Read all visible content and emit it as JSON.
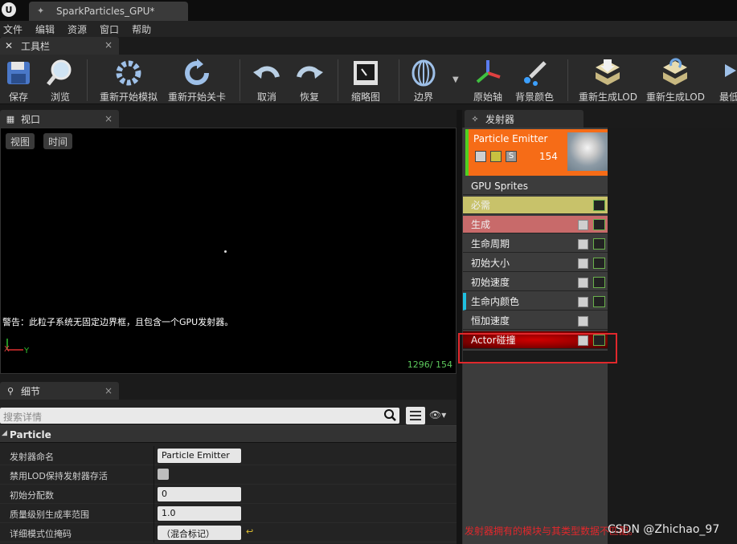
{
  "window": {
    "tab_title": "SparkParticles_GPU*"
  },
  "menu": [
    "文件",
    "编辑",
    "资源",
    "窗口",
    "帮助"
  ],
  "toolbar_tab": {
    "label": "工具栏"
  },
  "toolbar": {
    "buttons": [
      "保存",
      "浏览",
      "重新开始模拟",
      "重新开始关卡",
      "取消",
      "恢复",
      "缩略图",
      "边界",
      "原始轴",
      "背景颜色",
      "重新生成LOD",
      "重新生成LOD",
      "最低"
    ]
  },
  "viewport": {
    "tab_label": "视口",
    "view_button": "视图",
    "time_button": "时间",
    "warning": "警告：此粒子系统无固定边界框，且包含一个GPU发射器。",
    "counter": "1296/ 154",
    "axis_x": "X",
    "axis_y": "Y"
  },
  "details": {
    "tab_label": "细节",
    "search_placeholder": "搜索详情",
    "category": "Particle",
    "properties": [
      {
        "name": "发射器命名",
        "value": "Particle Emitter"
      },
      {
        "name": "禁用LOD保持发射器存活",
        "value": ""
      },
      {
        "name": "初始分配数",
        "value": "0"
      },
      {
        "name": "质量级别生成率范围",
        "value": "1.0"
      },
      {
        "name": "详细模式位掩码",
        "value": "（混合标记）"
      }
    ]
  },
  "emitters": {
    "tab_label": "发射器",
    "emitter_name": "Particle Emitter",
    "emitter_count": "154",
    "solo_label": "S",
    "type_row": "GPU Sprites",
    "modules": [
      "必需",
      "生成",
      "生命周期",
      "初始大小",
      "初始速度",
      "生命内颜色",
      "恒加速度",
      "Actor碰撞"
    ],
    "footer_note": "发射器拥有的模块与其类型数据不匹配。",
    "watermark": "CSDN @Zhichao_97"
  },
  "colors": {
    "emitter_header": "#f66c17",
    "required_row": "#c8c26a",
    "spawn_row": "#c86a6a",
    "highlight": "#e0282c"
  }
}
